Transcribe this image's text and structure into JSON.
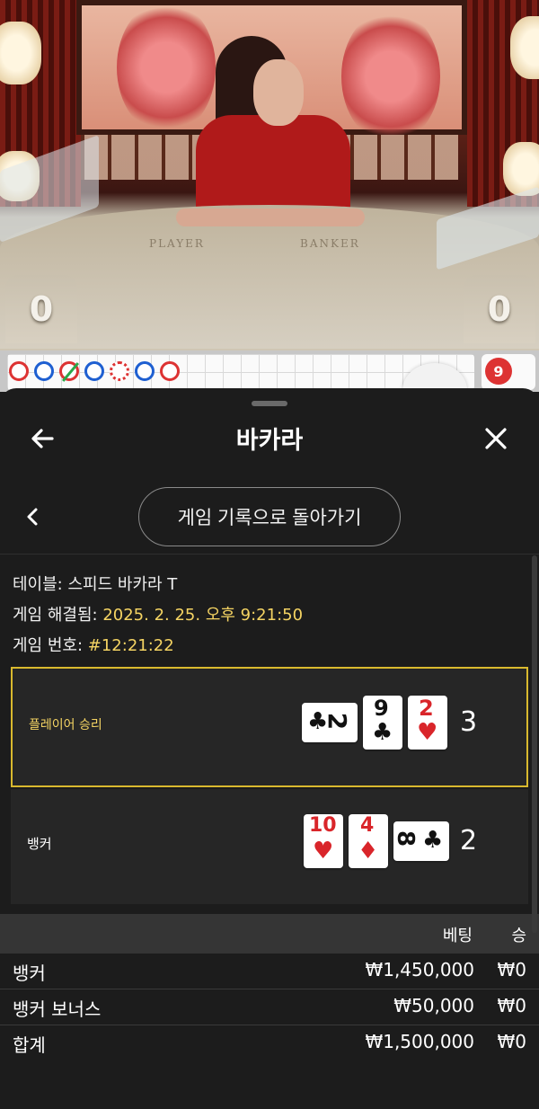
{
  "video": {
    "felt_player": "PLAYER",
    "felt_banker": "BANKER",
    "player_score": "0",
    "banker_score": "0"
  },
  "road": {
    "side_value": "9",
    "dots": [
      "red",
      "blue",
      "red-slash",
      "blue",
      "red-open",
      "blue",
      "red"
    ]
  },
  "sheet": {
    "title": "바카라",
    "back_to_history_label": "게임 기록으로 돌아가기"
  },
  "info": {
    "table_label": "테이블:",
    "table_value": "스피드 바카라 T",
    "resolved_label": "게임 해결됨:",
    "resolved_value": "2025. 2. 25. 오후 9:21:50",
    "number_label": "게임 번호:",
    "number_value": "#12:21:22"
  },
  "player": {
    "label": "플레이어 승리",
    "total": "3",
    "cards": [
      {
        "rank": "2",
        "suit": "♣",
        "color": "black",
        "orientation": "horizontal"
      },
      {
        "rank": "9",
        "suit": "♣",
        "color": "black",
        "orientation": "vertical"
      },
      {
        "rank": "2",
        "suit": "♥",
        "color": "red",
        "orientation": "vertical"
      }
    ]
  },
  "banker": {
    "label": "뱅커",
    "total": "2",
    "cards": [
      {
        "rank": "10",
        "suit": "♥",
        "color": "red",
        "orientation": "vertical"
      },
      {
        "rank": "4",
        "suit": "♦",
        "color": "red",
        "orientation": "vertical"
      },
      {
        "rank": "8",
        "suit": "♣",
        "color": "black",
        "orientation": "horizontal"
      }
    ]
  },
  "bets": {
    "header_bet": "베팅",
    "header_win": "승",
    "rows": [
      {
        "name": "뱅커",
        "amount": "₩1,450,000",
        "win": "₩0"
      },
      {
        "name": "뱅커 보너스",
        "amount": "₩50,000",
        "win": "₩0"
      },
      {
        "name": "합계",
        "amount": "₩1,500,000",
        "win": "₩0"
      }
    ]
  },
  "colors": {
    "accent_gold": "#d9b92e",
    "card_red": "#d9252a",
    "sheet_bg": "#1c1c1c"
  }
}
